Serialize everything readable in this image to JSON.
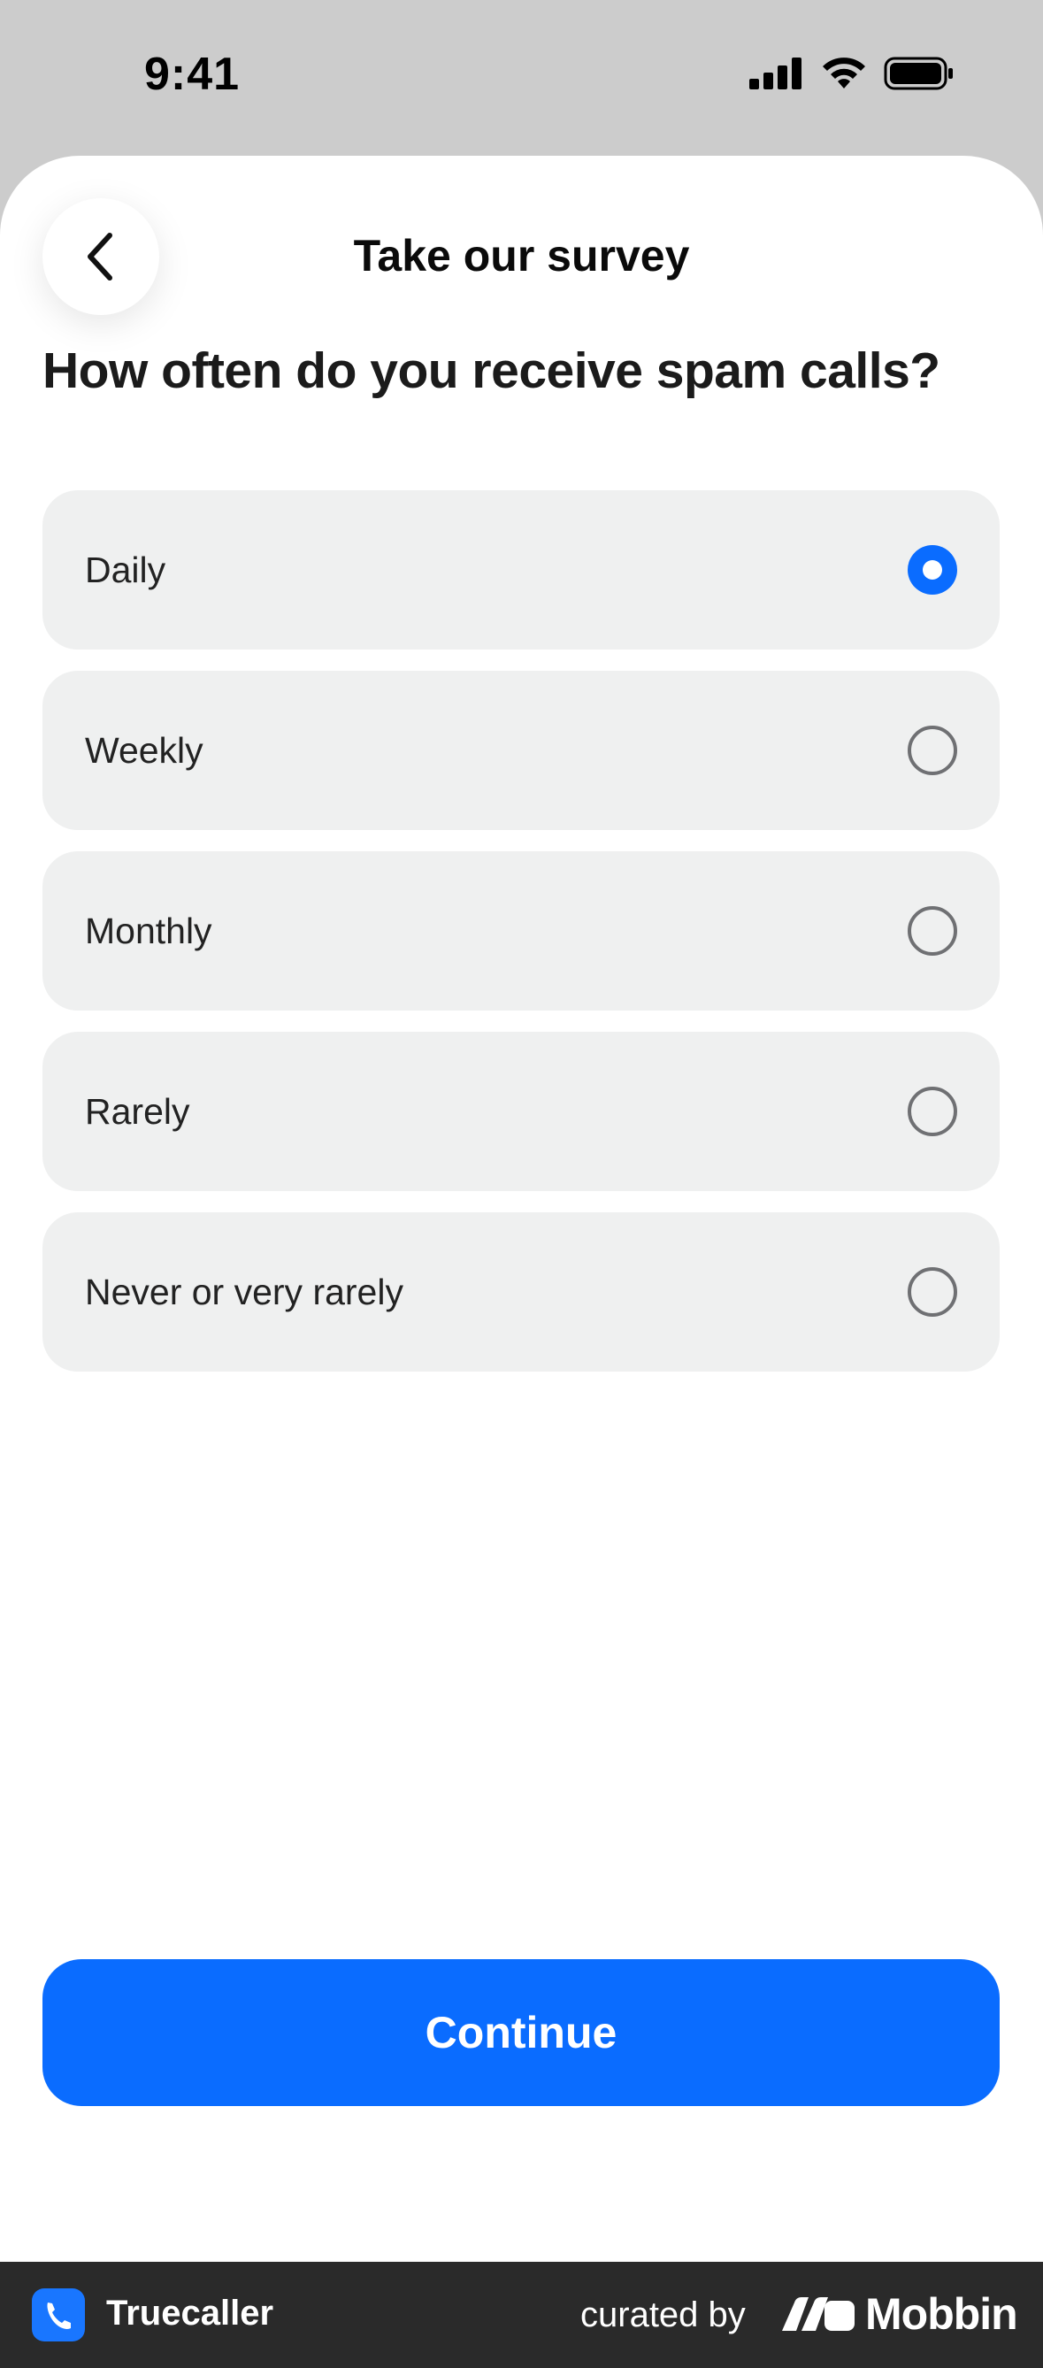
{
  "status_bar": {
    "time": "9:41",
    "icons": [
      "signal-icon",
      "wifi-icon",
      "battery-icon"
    ]
  },
  "header": {
    "back_icon": "chevron-left-icon",
    "title": "Take our survey"
  },
  "question": "How often do you receive spam calls?",
  "options": [
    {
      "label": "Daily",
      "selected": true
    },
    {
      "label": "Weekly",
      "selected": false
    },
    {
      "label": "Monthly",
      "selected": false
    },
    {
      "label": "Rarely",
      "selected": false
    },
    {
      "label": "Never or very rarely",
      "selected": false
    }
  ],
  "continue_label": "Continue",
  "footer": {
    "app_name": "Truecaller",
    "curated_by": "curated by",
    "brand": "Mobbin"
  },
  "colors": {
    "accent": "#0a6cff",
    "option_bg": "#eff0f0",
    "footer_bg": "#2a2a2a"
  }
}
